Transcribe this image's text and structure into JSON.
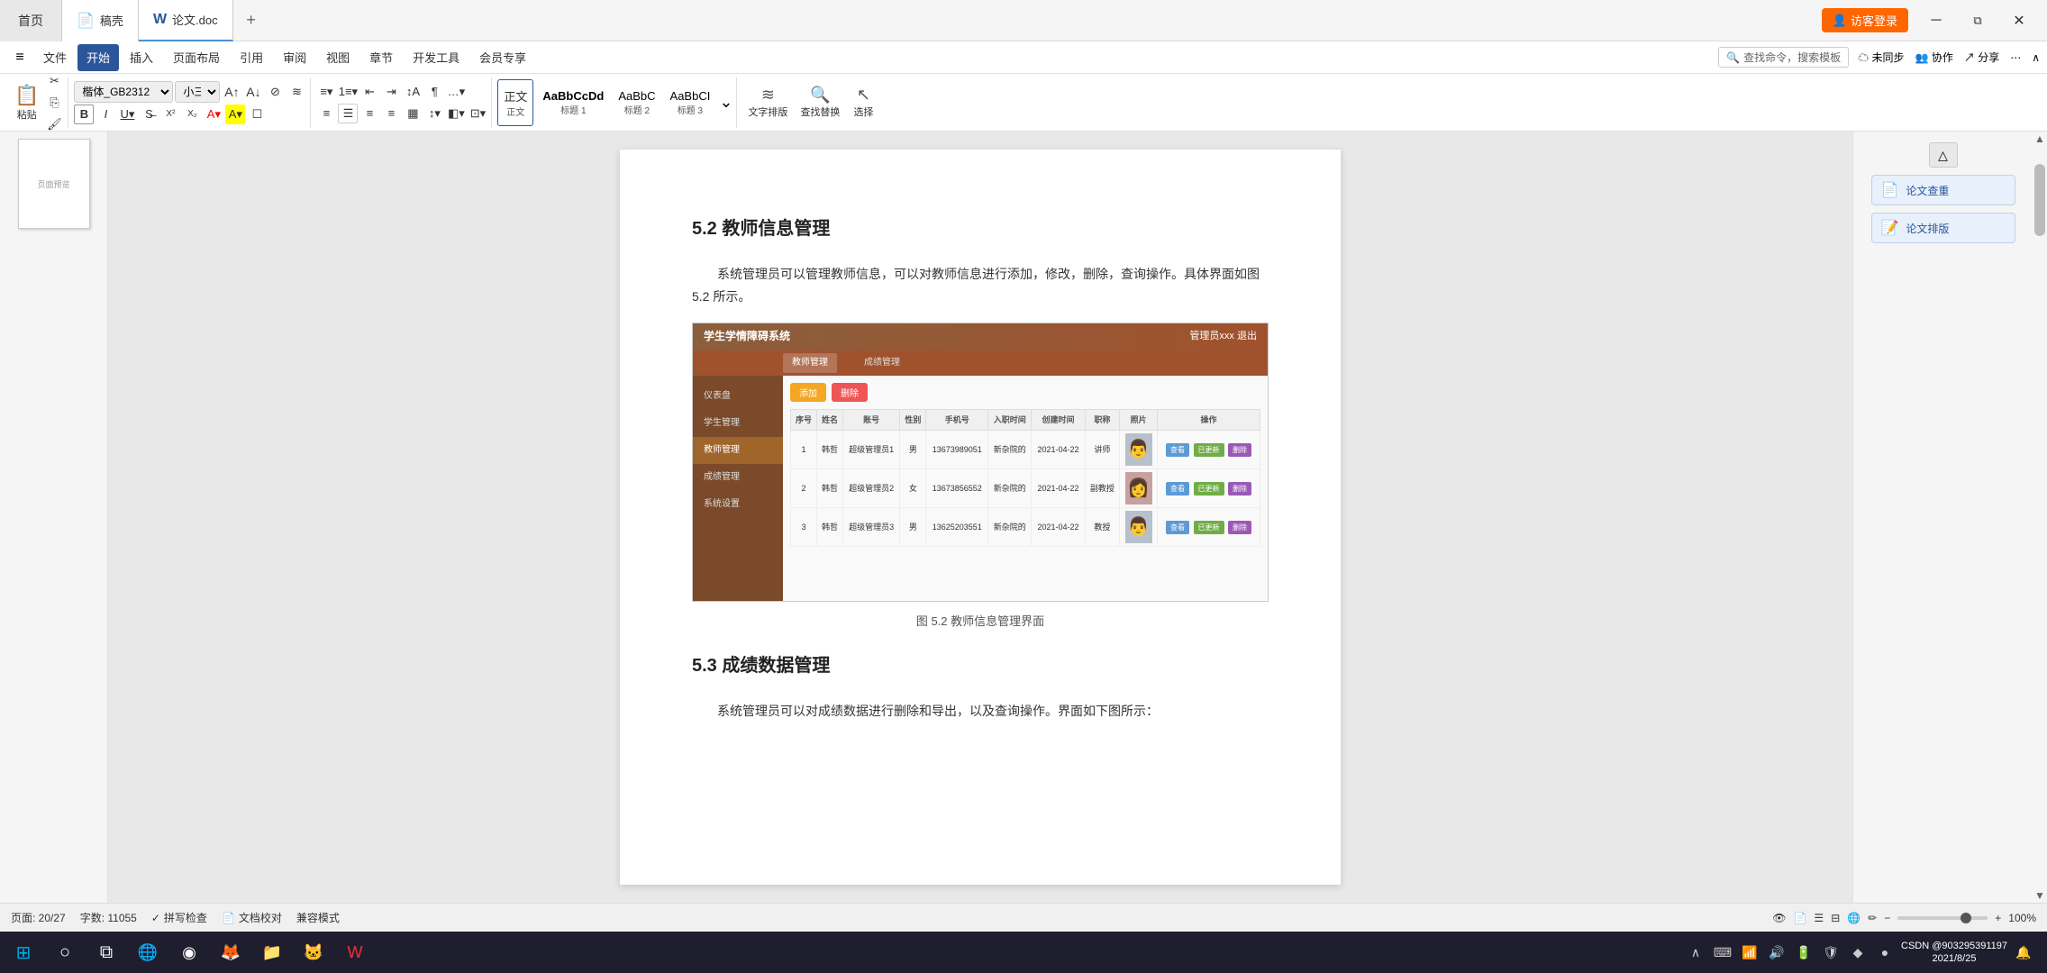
{
  "window": {
    "tab_home": "首页",
    "tab_wps": "稿壳",
    "tab_doc": "论文.doc",
    "tab_add": "+",
    "btn_login": "访客登录",
    "win_minimize": "─",
    "win_restore": "⧉",
    "win_close": "✕"
  },
  "menu": {
    "items": [
      "文件",
      "开始",
      "插入",
      "页面布局",
      "引用",
      "审阅",
      "视图",
      "章节",
      "开发工具",
      "会员专享"
    ],
    "active": "开始",
    "search_placeholder": "查找命令，搜索模板",
    "unsync": "未同步",
    "collab": "协作",
    "share": "分享"
  },
  "toolbar": {
    "paste": "粘贴",
    "cut": "剪切",
    "copy": "复制",
    "format_brush": "格式刷",
    "font": "楷体_GB2312",
    "size": "小三",
    "bold": "B",
    "italic": "I",
    "underline": "U",
    "styles": [
      "正文",
      "标题 1",
      "标题 2",
      "标题 3"
    ],
    "text_layout": "文字排版",
    "find_replace": "查找替换",
    "select": "选择"
  },
  "doc": {
    "section_5_2": {
      "title": "5.2  教师信息管理",
      "para1": "系统管理员可以管理教师信息，可以对教师信息进行添加，修改，删除，查询操作。具体界面如图 5.2 所示。",
      "fig_caption": "图 5.2  教师信息管理界面"
    },
    "section_5_3": {
      "title": "5.3  成绩数据管理",
      "para1": "系统管理员可以对成绩数据进行删除和导出，以及查询操作。界面如下图所示："
    }
  },
  "sys_screenshot": {
    "sys_title": "学生学情障碍系统",
    "header_right": "管理员xxx  退出",
    "menu_items": [
      "仪表盘",
      "学生管理",
      "教师管理",
      "成绩管理",
      "系统设置"
    ],
    "active_menu": "教师管理",
    "btn_add": "添加",
    "btn_delete": "删除",
    "table_headers": [
      "序号",
      "姓名",
      "账号",
      "性别",
      "手机号",
      "入职时间",
      "创建时间",
      "职称",
      "照片",
      "操作"
    ],
    "rows": [
      {
        "id": "1",
        "name": "韩哲",
        "account": "超级管理员1",
        "gender": "男",
        "phone": "13673989051",
        "hire": "新杂院的",
        "created": "2021-04-22",
        "title": "讲师",
        "actions": [
          "查看",
          "已更新",
          "删除"
        ]
      },
      {
        "id": "2",
        "name": "韩哲",
        "account": "超级管理员2",
        "gender": "女",
        "phone": "13673856552",
        "hire": "新杂院的",
        "created": "2021-04-22",
        "title": "副教授",
        "actions": [
          "查看",
          "已更新",
          "删除"
        ]
      },
      {
        "id": "3",
        "name": "韩哲",
        "account": "超级管理员3",
        "gender": "男",
        "phone": "13625203551",
        "hire": "新杂院的",
        "created": "2021-04-22",
        "title": "教授",
        "actions": [
          "查看",
          "已更新",
          "删除"
        ]
      }
    ]
  },
  "right_sidebar": {
    "collapse_icon": "△",
    "btn1_label": "论文查重",
    "btn2_label": "论文排版"
  },
  "status_bar": {
    "page": "页面: 20/27",
    "word_count": "字数: 11055",
    "spell_check": "拼写检查",
    "doc_compare": "文档校对",
    "compat": "兼容模式",
    "zoom": "100%",
    "zoom_out": "−",
    "zoom_in": "+"
  },
  "taskbar": {
    "windows_icon": "⊞",
    "cortana_icon": "○",
    "task_view": "⧉",
    "clock_time": "2021/8/25",
    "clock_date": "CSDN @903295391197",
    "app_icons": [
      "🌐",
      "◉",
      "🦊",
      "📁",
      "🐱",
      "W"
    ]
  }
}
